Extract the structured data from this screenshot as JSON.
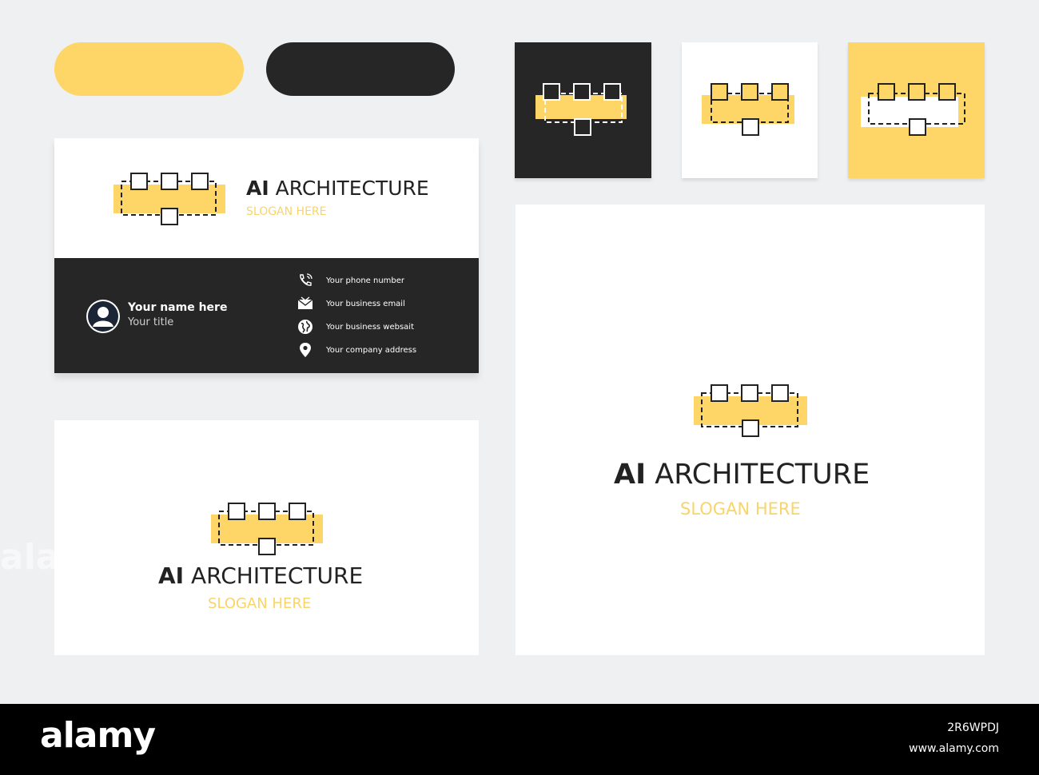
{
  "colors": {
    "accent_yellow": "#fdd667",
    "dark": "#262626",
    "background": "#eff0f2",
    "white": "#ffffff"
  },
  "brand": {
    "name_bold": "AI",
    "name_light": "ARCHITECTURE",
    "slogan": "SLOGAN HERE"
  },
  "business_card": {
    "person_name": "Your name here",
    "person_title": "Your title",
    "contacts": [
      {
        "icon": "phone-icon",
        "label": "Your phone number"
      },
      {
        "icon": "envelope-icon",
        "label": "Your business email"
      },
      {
        "icon": "globe-icon",
        "label": "Your business websait"
      },
      {
        "icon": "location-pin-icon",
        "label": "Your company address"
      }
    ]
  },
  "footer": {
    "logo": "alamy",
    "image_id": "2R6WPDJ",
    "site": "www.alamy.com"
  },
  "watermark": "alamy"
}
